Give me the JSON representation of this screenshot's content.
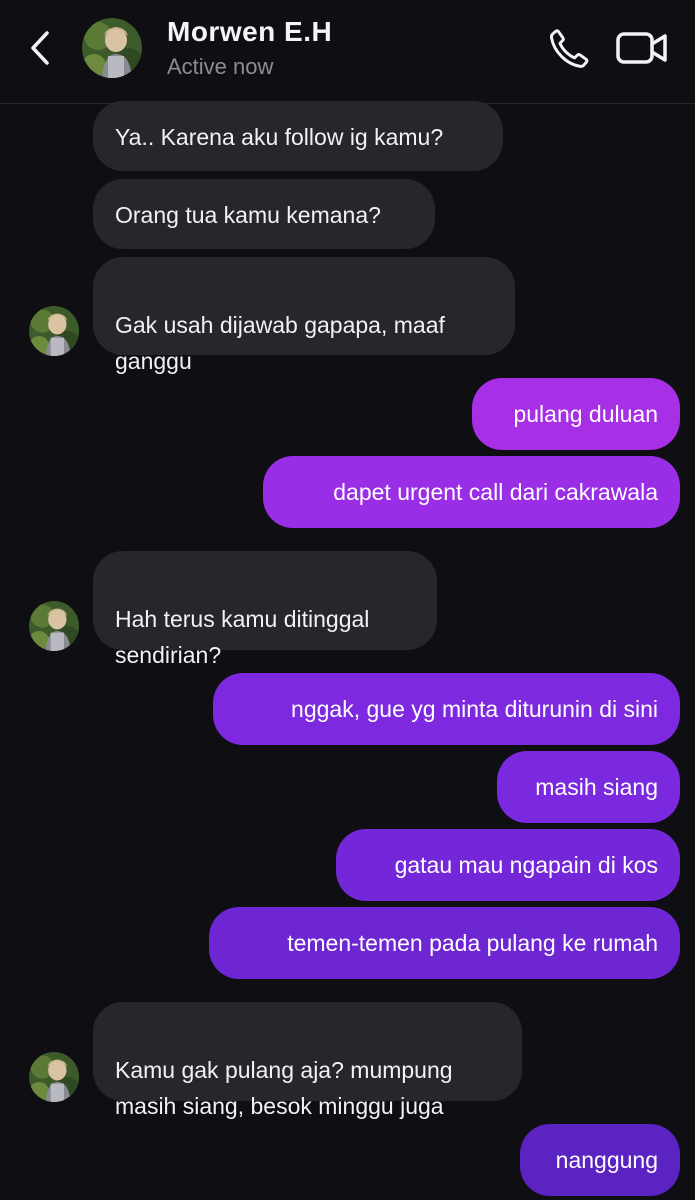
{
  "header": {
    "name": "Morwen E.H",
    "status": "Active now"
  },
  "messages": [
    {
      "dir": "in",
      "text": "Ya.. Karena aku follow ig kamu?"
    },
    {
      "dir": "in",
      "text": "Orang tua kamu kemana?"
    },
    {
      "dir": "in",
      "text": "Gak usah dijawab gapapa, maaf\nganggu"
    },
    {
      "dir": "out",
      "text": "pulang duluan",
      "color": "#a72fe6"
    },
    {
      "dir": "out",
      "text": "dapet urgent call dari cakrawala",
      "color": "#9a2ee6"
    },
    {
      "dir": "in",
      "text": "Hah terus kamu ditinggal\nsendirian?"
    },
    {
      "dir": "out",
      "text": "nggak, gue yg minta diturunin di sini",
      "color": "#7e29e0"
    },
    {
      "dir": "out",
      "text": "masih siang",
      "color": "#7a29de"
    },
    {
      "dir": "out",
      "text": "gatau mau ngapain di kos",
      "color": "#7427d8"
    },
    {
      "dir": "out",
      "text": "temen-temen pada pulang ke rumah",
      "color": "#6e26d2"
    },
    {
      "dir": "in",
      "text": "Kamu gak pulang aja? mumpung\nmasih siang, besok minggu juga"
    },
    {
      "dir": "out",
      "text": "nanggung",
      "color": "#5a23c2"
    }
  ],
  "colors": {
    "background": "#0e0e13",
    "incoming_bubble": "#26272b"
  }
}
